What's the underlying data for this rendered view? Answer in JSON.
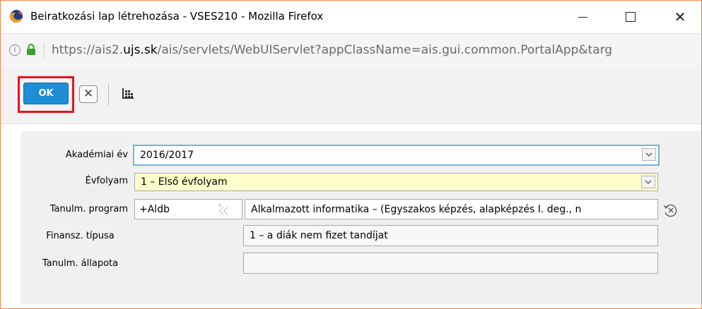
{
  "window": {
    "title": "Beiratkozási lap létrehozása - VSES210 - Mozilla Firefox",
    "minimize_glyph": "—",
    "maximize_glyph": "☐",
    "close_glyph": "✕"
  },
  "urlbar": {
    "info_glyph": "i",
    "url_prefix": "https://ais2.",
    "url_domain": "ujs.sk",
    "url_rest": "/ais/servlets/WebUIServlet?appClassName=ais.gui.common.PortalApp&targ"
  },
  "toolbar": {
    "ok_label": "OK",
    "cancel_glyph": "✕",
    "ok_highlight_color": "#e1141e",
    "ok_color": "#1d8ed6"
  },
  "form": {
    "akademiai_ev": {
      "label": "Akadémiai év",
      "value": "2016/2017"
    },
    "evfolyam": {
      "label": "Évfolyam",
      "value": "1 – Első évfolyam"
    },
    "tanulm_program": {
      "label": "Tanulm. program",
      "code": "+Aldb",
      "value": "Alkalmazott informatika – (Egyszakos képzés, alapképzés I. deg., n"
    },
    "finansz_tipusa": {
      "label": "Finansz. típusa",
      "value": "1 – a diák nem fizet tandíjat"
    },
    "tanulm_allapota": {
      "label": "Tanulm. állapota",
      "value": ""
    }
  }
}
